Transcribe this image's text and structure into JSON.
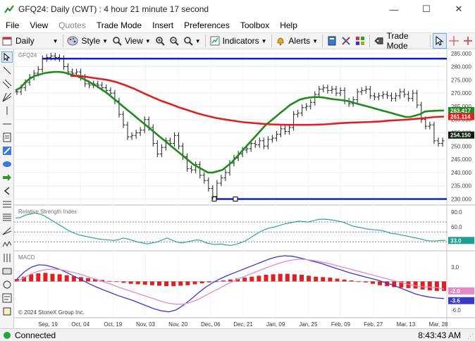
{
  "window": {
    "title": "GFQ24: Daily (CWT) : 4 hour 21 minute 17 second",
    "minimize": "—",
    "maximize": "☐",
    "close": "✕"
  },
  "menu": {
    "items": [
      "File",
      "View",
      "Quotes",
      "Trade Mode",
      "Insert",
      "Preferences",
      "Toolbox",
      "Help"
    ],
    "disabled": [
      false,
      false,
      true,
      false,
      false,
      false,
      false,
      false
    ]
  },
  "toolbar": {
    "period": "Daily",
    "style": "Style",
    "view": "View",
    "indicators": "Indicators",
    "alerts": "Alerts",
    "trade_mode": "Trade Mode"
  },
  "status": {
    "connection": "Connected",
    "time": "8:43:43 AM"
  },
  "chart_data": [
    {
      "type": "candlestick",
      "title": "GFQ24",
      "ylim": [
        228,
        286
      ],
      "y_ticks": [
        285,
        280,
        275,
        270,
        265,
        260,
        255,
        250,
        245,
        240,
        235,
        230
      ],
      "y_tick_labels": [
        "285.000",
        "280.000",
        "275.000",
        "270.000",
        "265.000",
        "260.000",
        "255.000",
        "250.000",
        "245.000",
        "240.000",
        "235.000",
        "230.000"
      ],
      "x_tick_labels": [
        "Sep, 19",
        "Oct, 04",
        "Oct, 19",
        "Nov, 03",
        "Nov, 20",
        "Dec, 06",
        "Dec, 21",
        "Jan, 09",
        "Jan, 25",
        "Feb, 09",
        "Feb, 27",
        "Mar, 13",
        "Mar, 28"
      ],
      "close": [
        270.5,
        272.0,
        274.0,
        276.0,
        277.5,
        279.0,
        283.0,
        283.5,
        284.0,
        283.5,
        283.0,
        280.0,
        278.0,
        277.5,
        278.0,
        276.0,
        273.5,
        273.0,
        273.5,
        273.0,
        272.0,
        271.0,
        270.0,
        267.0,
        262.0,
        258.0,
        253.5,
        254.0,
        255.0,
        256.0,
        260.0,
        257.0,
        251.0,
        247.0,
        249.5,
        252.0,
        251.0,
        254.0,
        250.0,
        246.0,
        241.5,
        241.0,
        243.0,
        239.0,
        237.0,
        234.0,
        231.0,
        236.0,
        238.0,
        240.0,
        243.5,
        245.5,
        247.0,
        248.5,
        249.0,
        251.0,
        250.5,
        252.0,
        250.0,
        252.5,
        253.0,
        254.5,
        256.5,
        255.5,
        257.0,
        262.0,
        262.5,
        264.5,
        265.0,
        266.5,
        269.5,
        271.5,
        272.0,
        271.0,
        271.5,
        270.0,
        271.0,
        267.0,
        266.0,
        267.5,
        270.5,
        271.0,
        271.5,
        269.0,
        268.5,
        269.0,
        269.5,
        269.0,
        268.0,
        269.0,
        270.5,
        269.5,
        268.0,
        270.0,
        265.5,
        260.0,
        257.5,
        258.0,
        252.0,
        251.0,
        252.0
      ],
      "levels": [
        {
          "value": 283.0,
          "color": "#1020d0"
        },
        {
          "value": 230.0,
          "color": "#1020d0"
        }
      ],
      "series": [
        {
          "name": "",
          "color": "#1f8a1f",
          "values": [
            271,
            272,
            274,
            275.5,
            276.5,
            277,
            277.5,
            277.8,
            278,
            278,
            277.8,
            277.3,
            276.8,
            276.2,
            275.5,
            274.5,
            273.5,
            272.5,
            271.2,
            270,
            268.5,
            267,
            265.5,
            264,
            262.5,
            261,
            259.5,
            258,
            256.5,
            255,
            253.5,
            252,
            250.5,
            249,
            247.5,
            246,
            244.5,
            243,
            242,
            241,
            240,
            240,
            240.5,
            241,
            242.5,
            244,
            246,
            248,
            250,
            252,
            254,
            256,
            258,
            259.5,
            261,
            262.5,
            264,
            265.5,
            266.5,
            267.5,
            268,
            268.3,
            268.5,
            268.5,
            268.3,
            268,
            267.7,
            267.5,
            267.3,
            267,
            266.5,
            266,
            265.5,
            265,
            264.5,
            264,
            263.5,
            263,
            262.5,
            262,
            261.5,
            261,
            261,
            261.5,
            262,
            263,
            263.2,
            263.3,
            263.4,
            263.417
          ]
        },
        {
          "name": "",
          "color": "#e02020",
          "values": [
            276.5,
            276.5,
            276,
            275.5,
            275,
            274.2,
            273,
            271.6,
            270,
            268.5,
            267,
            265.8,
            264.5,
            263.4,
            262.3,
            261.4,
            260.6,
            260,
            259.5,
            259,
            258.7,
            258.4,
            258.2,
            258.1,
            258,
            258,
            258,
            258.1,
            258.2,
            258.5,
            258.7,
            258.9,
            259,
            259.1,
            259.3,
            259.6,
            259.8,
            260,
            260.3,
            260.6,
            261,
            261.114
          ]
        }
      ],
      "price_tags": [
        {
          "label": "263.417",
          "bg": "#1f8a1f"
        },
        {
          "label": "261.114",
          "bg": "#e02020"
        },
        {
          "label": "254.150",
          "bg": "#0d1a10"
        }
      ],
      "footnote": "© 2024 StoneX Group Inc."
    },
    {
      "type": "line",
      "title": "Relative Strength Index",
      "ylim": [
        15,
        100
      ],
      "y_tick_labels": [
        "90.0",
        "60.0"
      ],
      "levels": [
        70,
        50,
        30
      ],
      "series": [
        {
          "name": "",
          "color": "#1f9d93",
          "values": [
            78,
            79,
            84,
            86,
            88,
            86,
            82,
            76,
            70,
            64,
            58,
            52,
            48,
            44,
            42,
            40,
            38,
            36,
            35,
            34,
            33,
            34,
            38,
            36,
            33,
            30,
            28,
            26,
            28,
            30,
            34,
            38,
            34,
            30,
            28,
            30,
            32,
            34,
            33,
            28,
            26,
            25,
            26,
            24,
            23,
            25,
            28,
            32,
            38,
            44,
            50,
            55,
            58,
            60,
            63,
            66,
            68,
            70,
            72,
            71,
            70,
            73,
            75,
            76,
            75,
            74,
            72,
            70,
            66,
            62,
            60,
            58,
            56,
            55,
            54,
            53,
            50,
            47,
            46,
            44,
            42,
            40,
            38,
            36,
            33,
            32,
            32,
            33,
            33
          ]
        }
      ],
      "value_tag": {
        "label": "33.0",
        "bg": "#1f9d93"
      }
    },
    {
      "type": "line",
      "title": "MACD",
      "ylim": [
        -7.5,
        6
      ],
      "y_tick_labels": [
        "3.0",
        "-6.0"
      ],
      "histogram": [
        0.5,
        1.0,
        1.5,
        1.7,
        1.8,
        1.6,
        1.5,
        1.3,
        1.1,
        0.9,
        0.7,
        0.5,
        0.3,
        0.1,
        -0.1,
        -0.3,
        -0.5,
        -0.6,
        -0.7,
        -0.8,
        -0.9,
        -1.0,
        -1.0,
        -0.9,
        -0.8,
        -0.6,
        -0.4,
        -0.2,
        0.0,
        0.2,
        0.4,
        0.6,
        0.8,
        1.0,
        1.2,
        1.4,
        1.5,
        1.6,
        1.6,
        1.5,
        1.4,
        1.2,
        1.0,
        0.9,
        0.8,
        0.6,
        0.4,
        0.2,
        0.0,
        -0.2,
        -0.5,
        -0.8,
        -1.0,
        -1.2,
        -1.3,
        -1.4,
        -1.5,
        -1.7,
        -1.9,
        -2.0,
        -2.0
      ],
      "series": [
        {
          "name": "",
          "color": "#3a3ac8",
          "values": [
            0.5,
            2.0,
            3.0,
            3.5,
            3.4,
            3.0,
            2.5,
            1.8,
            1.0,
            0.3,
            -0.5,
            -1.2,
            -1.8,
            -2.4,
            -3.0,
            -3.5,
            -4.0,
            -4.6,
            -5.2,
            -5.8,
            -6.2,
            -6.4,
            -6.0,
            -5.0,
            -3.8,
            -2.5,
            -1.3,
            -0.3,
            0.5,
            1.2,
            1.8,
            2.4,
            3.0,
            3.6,
            4.2,
            4.8,
            5.2,
            5.4,
            5.3,
            5.0,
            4.6,
            4.2,
            3.8,
            3.3,
            2.8,
            2.3,
            1.8,
            1.4,
            1.0,
            0.6,
            0.2,
            -0.3,
            -0.8,
            -1.4,
            -2.0,
            -2.6,
            -3.0,
            -3.3,
            -3.5,
            -3.6
          ]
        },
        {
          "name": "",
          "color": "#e48ac8",
          "values": [
            0.0,
            0.8,
            1.6,
            2.2,
            2.5,
            2.6,
            2.5,
            2.2,
            1.8,
            1.4,
            0.9,
            0.4,
            -0.1,
            -0.6,
            -1.2,
            -1.7,
            -2.2,
            -2.7,
            -3.2,
            -3.7,
            -4.2,
            -4.6,
            -4.8,
            -4.8,
            -4.4,
            -3.8,
            -3.0,
            -2.2,
            -1.4,
            -0.6,
            0.1,
            0.8,
            1.4,
            2.0,
            2.6,
            3.2,
            3.7,
            4.2,
            4.5,
            4.7,
            4.6,
            4.4,
            4.1,
            3.8,
            3.4,
            3.0,
            2.6,
            2.2,
            1.8,
            1.4,
            1.0,
            0.6,
            0.2,
            -0.2,
            -0.6,
            -0.9,
            -1.1,
            -1.2,
            -1.3,
            -1.6
          ]
        }
      ],
      "value_tags": [
        {
          "label": "-2.0",
          "bg": "#e48ac8"
        },
        {
          "label": "-3.6",
          "bg": "#3a3ac8"
        }
      ]
    }
  ]
}
